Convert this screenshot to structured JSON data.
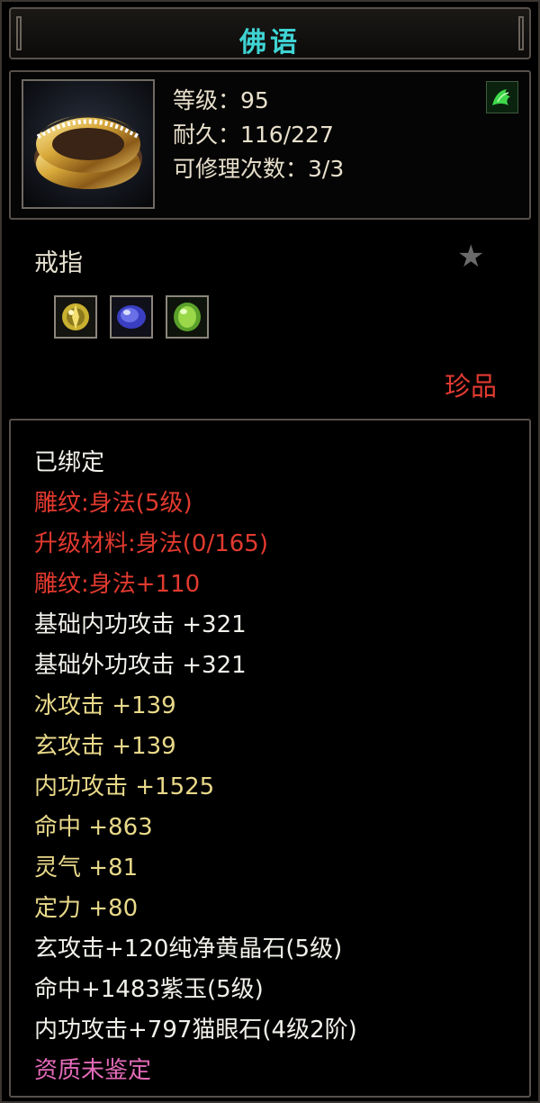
{
  "item": {
    "name": "佛语",
    "stats": {
      "level": "等级：95",
      "durability": "耐久：116/227",
      "repairs": "可修理次数：3/3"
    },
    "type": "戒指",
    "rarity": "珍品",
    "icon": "gold-ring-icon",
    "badge_icon": "green-dragon-icon",
    "favorite_icon": "star-icon",
    "gem_sockets": [
      {
        "icon": "yellow-crystal-gem-icon"
      },
      {
        "icon": "purple-jade-gem-icon"
      },
      {
        "icon": "green-cats-eye-gem-icon"
      }
    ]
  },
  "properties": [
    {
      "text": "已绑定",
      "color": "white"
    },
    {
      "text": "雕纹:身法(5级)",
      "color": "red"
    },
    {
      "text": "升级材料:身法(0/165)",
      "color": "red"
    },
    {
      "text": "雕纹:身法+110",
      "color": "red"
    },
    {
      "text": "基础内功攻击 +321",
      "color": "white"
    },
    {
      "text": "基础外功攻击 +321",
      "color": "white"
    },
    {
      "text": "冰攻击 +139",
      "color": "yellow"
    },
    {
      "text": "玄攻击 +139",
      "color": "yellow"
    },
    {
      "text": "内功攻击 +1525",
      "color": "yellow"
    },
    {
      "text": "命中 +863",
      "color": "yellow"
    },
    {
      "text": "灵气 +81",
      "color": "yellow"
    },
    {
      "text": "定力 +80",
      "color": "yellow"
    },
    {
      "text": "玄攻击+120纯净黄晶石(5级)",
      "color": "white"
    },
    {
      "text": "命中+1483紫玉(5级)",
      "color": "white"
    },
    {
      "text": "内功攻击+797猫眼石(4级2阶)",
      "color": "white"
    },
    {
      "text": "资质未鉴定",
      "color": "pink"
    }
  ],
  "colors": {
    "title": "#3fd3d3",
    "red": "#e23a2f",
    "yellow": "#e9d98a",
    "white": "#f2f0ea",
    "pink": "#e36ab8",
    "rarity": "#e03a30"
  }
}
